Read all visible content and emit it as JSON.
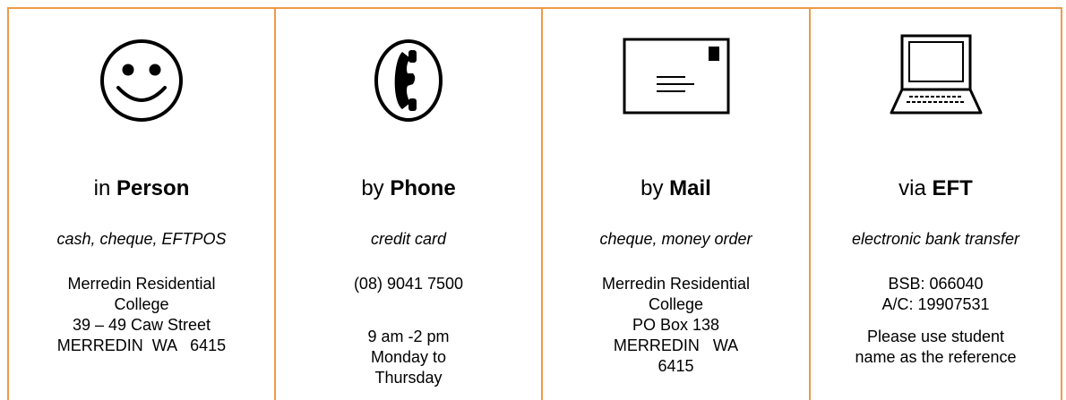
{
  "methods": [
    {
      "icon": "smiley-face-icon",
      "prefix": "in",
      "name": "Person",
      "subtitle": "cash, cheque, EFTPOS",
      "details": [
        [
          "Merredin Residential",
          "College",
          "39 – 49 Caw Street",
          "MERREDIN  WA   6415"
        ]
      ]
    },
    {
      "icon": "telephone-handset-icon",
      "prefix": "by",
      "name": "Phone",
      "subtitle": "credit card",
      "details": [
        [
          "(08) 9041 7500"
        ],
        [
          "9 am -2 pm",
          "Monday to",
          "Thursday"
        ]
      ]
    },
    {
      "icon": "envelope-icon",
      "prefix": "by",
      "name": "Mail",
      "subtitle": "cheque, money order",
      "details": [
        [
          "Merredin Residential",
          "College",
          "PO Box 138",
          "MERREDIN   WA",
          "6415"
        ]
      ]
    },
    {
      "icon": "laptop-computer-icon",
      "prefix": "via",
      "name": "EFT",
      "subtitle": "electronic bank transfer",
      "details": [
        [
          "BSB: 066040",
          "A/C: 19907531"
        ],
        [
          "Please use student",
          "name as the reference"
        ]
      ]
    }
  ]
}
